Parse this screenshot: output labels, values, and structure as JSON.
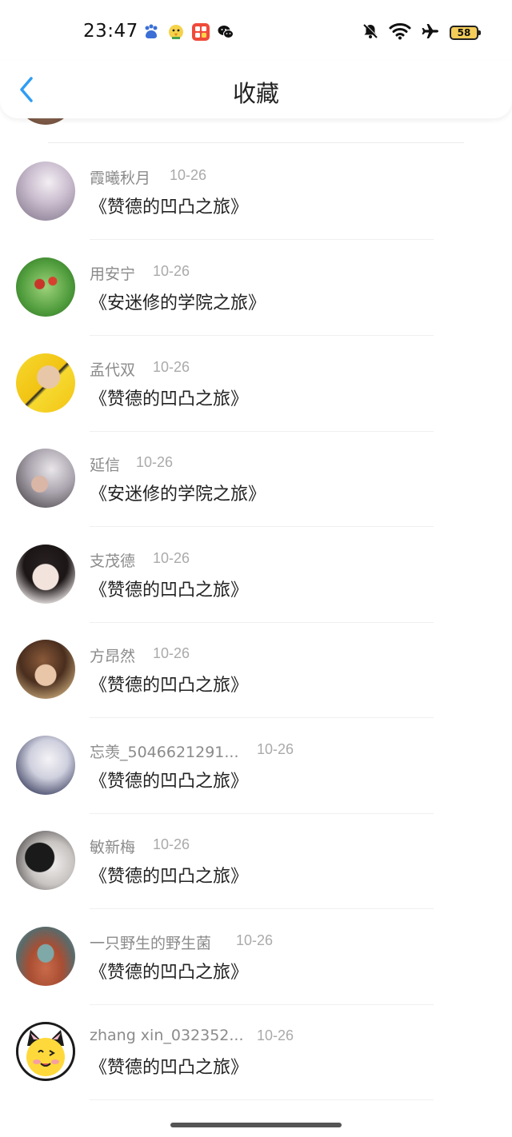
{
  "status_bar": {
    "time": "23:47",
    "battery": "58",
    "app_icons": [
      "baidu-icon",
      "chick-icon",
      "video-app-icon",
      "wechat-icon"
    ],
    "system_icons": [
      "mute-icon",
      "wifi-icon",
      "airplane-icon",
      "battery-icon"
    ]
  },
  "header": {
    "title": "收藏",
    "back_icon": "chevron-left-icon",
    "accent_color": "#2f9df4"
  },
  "favorites": [
    {
      "name": "霞曦秋月",
      "date": "10-26",
      "book": "《赞德的凹凸之旅》"
    },
    {
      "name": "用安宁",
      "date": "10-26",
      "book": "《安迷修的学院之旅》"
    },
    {
      "name": "孟代双",
      "date": "10-26",
      "book": "《赞德的凹凸之旅》"
    },
    {
      "name": "延信",
      "date": "10-26",
      "book": "《安迷修的学院之旅》"
    },
    {
      "name": "支茂德",
      "date": "10-26",
      "book": "《赞德的凹凸之旅》"
    },
    {
      "name": "方昂然",
      "date": "10-26",
      "book": "《赞德的凹凸之旅》"
    },
    {
      "name": "忘羡_5046621291...",
      "date": "10-26",
      "book": "《赞德的凹凸之旅》"
    },
    {
      "name": "敏新梅",
      "date": "10-26",
      "book": "《赞德的凹凸之旅》"
    },
    {
      "name": "一只野生的野生菌",
      "date": "10-26",
      "book": "《赞德的凹凸之旅》"
    },
    {
      "name": "zhang xin_032352...",
      "date": "10-26",
      "book": "《赞德的凹凸之旅》"
    }
  ]
}
